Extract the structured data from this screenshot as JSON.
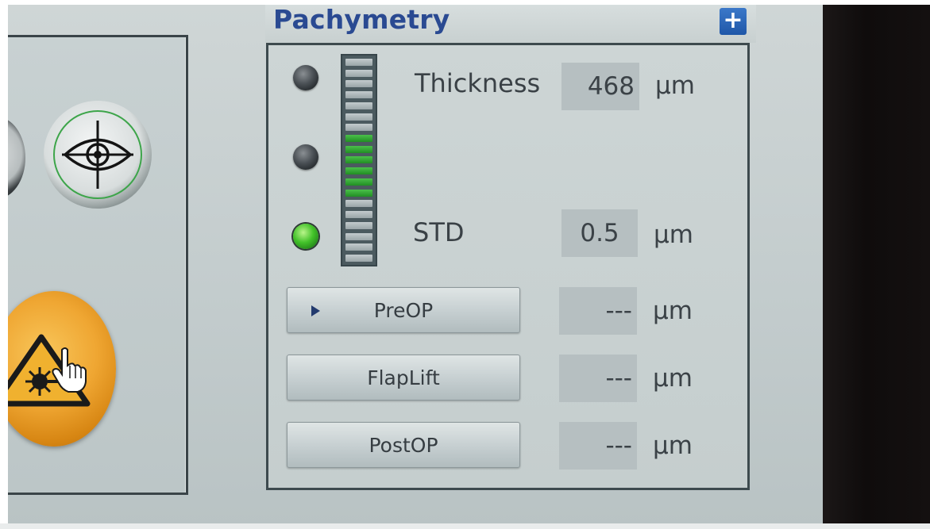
{
  "pachymetry": {
    "title": "Pachymetry",
    "expand_symbol": "+",
    "gauge": {
      "segments": 19,
      "active_from": 7,
      "active_to": 12
    },
    "thickness": {
      "label": "Thickness",
      "value": "468",
      "unit": "µm"
    },
    "std": {
      "label": "STD",
      "value": "0.5",
      "unit": "µm"
    },
    "measurements": [
      {
        "button": "PreOP",
        "value": "---",
        "unit": "µm",
        "selected": true
      },
      {
        "button": "FlapLift",
        "value": "---",
        "unit": "µm",
        "selected": false
      },
      {
        "button": "PostOP",
        "value": "---",
        "unit": "µm",
        "selected": false
      }
    ],
    "leds": [
      {
        "state": "off"
      },
      {
        "state": "off"
      },
      {
        "state": "on"
      }
    ]
  },
  "left_panel": {
    "eye_button_icon": "eye-crosshair-icon",
    "laser_button_icon": "laser-warning-icon",
    "cursor_icon": "hand-pointer-icon"
  },
  "colors": {
    "title_blue": "#2a4a92",
    "led_on": "#43c22a",
    "gauge_active": "#2fa534",
    "laser_orange": "#efa632"
  }
}
